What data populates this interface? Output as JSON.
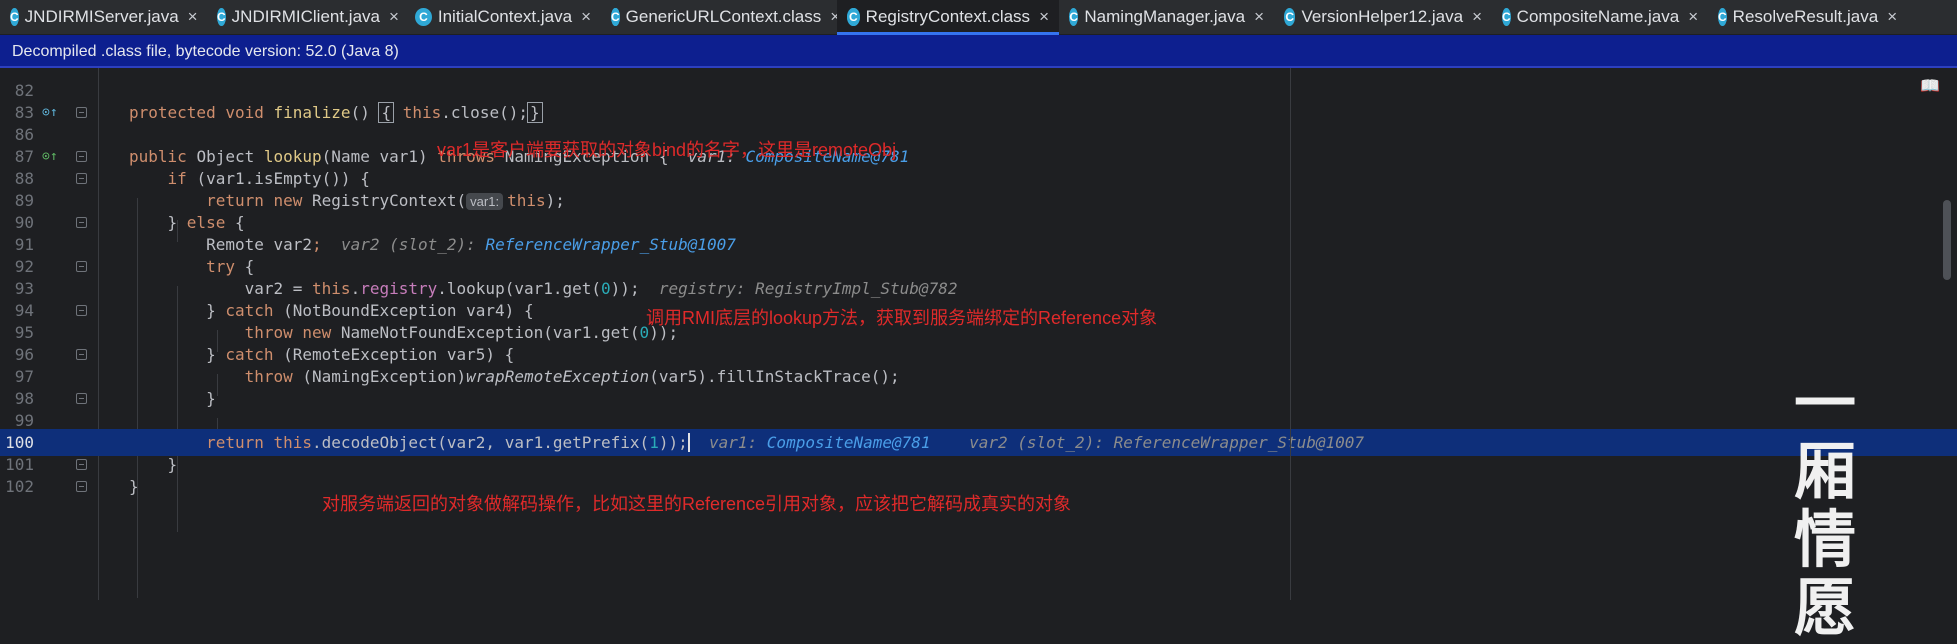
{
  "tabs": [
    {
      "name": "JNDIRMIServer.java",
      "icon": "C",
      "active": false
    },
    {
      "name": "JNDIRMIClient.java",
      "icon": "C",
      "active": false
    },
    {
      "name": "InitialContext.java",
      "icon": "C",
      "active": false
    },
    {
      "name": "GenericURLContext.class",
      "icon": "C",
      "active": false
    },
    {
      "name": "RegistryContext.class",
      "icon": "C",
      "active": true
    },
    {
      "name": "NamingManager.java",
      "icon": "C",
      "active": false
    },
    {
      "name": "VersionHelper12.java",
      "icon": "C",
      "active": false
    },
    {
      "name": "CompositeName.java",
      "icon": "C",
      "active": false
    },
    {
      "name": "ResolveResult.java",
      "icon": "C",
      "active": false
    }
  ],
  "tab_close": "×",
  "banner": {
    "text": "Decompiled .class file, bytecode version: 52.0 (Java 8)"
  },
  "line_numbers": [
    "82",
    "83",
    "86",
    "87",
    "88",
    "89",
    "90",
    "91",
    "92",
    "93",
    "94",
    "95",
    "96",
    "97",
    "98",
    "99",
    "100",
    "101",
    "102"
  ],
  "annotations": {
    "a1": "var1是客户端要获取的对象bind的名字，这里是remoteObj",
    "a2": "调用RMI底层的lookup方法，获取到服务端绑定的Reference对象",
    "a3": "对服务端返回的对象做解码操作，比如这里的Reference引用对象，应该把它解码成真实的对象"
  },
  "hints": {
    "var1_comp": "var1: ",
    "comp781": "CompositeName@781",
    "var2_slot": "var2 (slot_2): ",
    "refstub": "ReferenceWrapper_Stub@1007",
    "registry": "registry: RegistryImpl_Stub@782",
    "param_var1": "var1:"
  },
  "watermark": "一厢情愿",
  "colors": {
    "current_line": "#0e2f7a",
    "banner": "#0d1f8f",
    "annotation": "#e02a2a",
    "accent": "#3574f0"
  }
}
